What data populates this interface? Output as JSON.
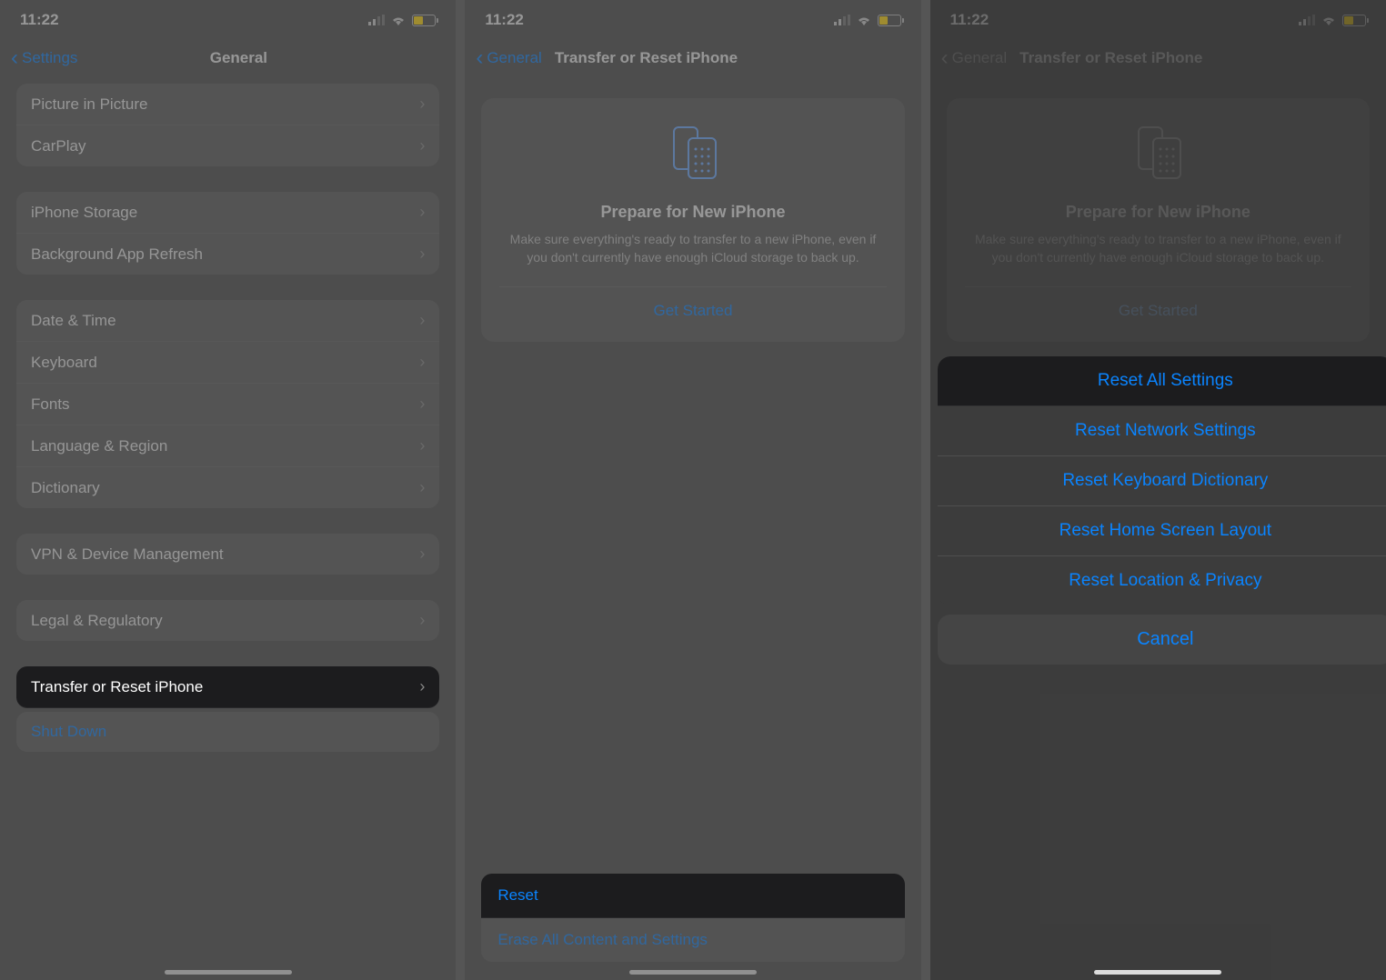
{
  "status": {
    "time": "11:22"
  },
  "screen1": {
    "back": "Settings",
    "title": "General",
    "g1": [
      "Picture in Picture",
      "CarPlay"
    ],
    "g2": [
      "iPhone Storage",
      "Background App Refresh"
    ],
    "g3": [
      "Date & Time",
      "Keyboard",
      "Fonts",
      "Language & Region",
      "Dictionary"
    ],
    "g4": [
      "VPN & Device Management"
    ],
    "g5": [
      "Legal & Regulatory"
    ],
    "transferReset": "Transfer or Reset iPhone",
    "shutDown": "Shut Down"
  },
  "screen2": {
    "back": "General",
    "title": "Transfer or Reset iPhone",
    "prepare": {
      "title": "Prepare for New iPhone",
      "desc": "Make sure everything's ready to transfer to a new iPhone, even if you don't currently have enough iCloud storage to back up.",
      "cta": "Get Started"
    },
    "reset": "Reset",
    "erase": "Erase All Content and Settings"
  },
  "screen3": {
    "back": "General",
    "title": "Transfer or Reset iPhone",
    "sheet": {
      "o1": "Reset All Settings",
      "o2": "Reset Network Settings",
      "o3": "Reset Keyboard Dictionary",
      "o4": "Reset Home Screen Layout",
      "o5": "Reset Location & Privacy",
      "cancel": "Cancel"
    }
  }
}
